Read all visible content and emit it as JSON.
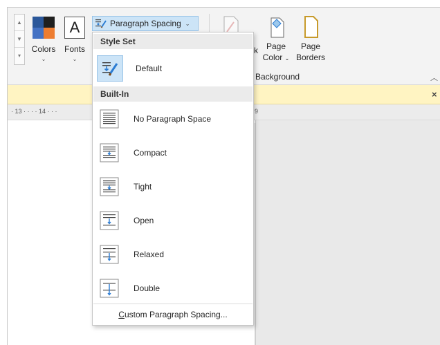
{
  "ribbon": {
    "colors_label": "Colors",
    "fonts_label": "Fonts",
    "fonts_glyph": "A",
    "paragraph_spacing_label": "Paragraph Spacing",
    "truncated_label": "k",
    "page_color_line1": "Page",
    "page_color_line2": "Color",
    "page_borders_line1": "Page",
    "page_borders_line2": "Borders",
    "group_label": "Background",
    "theme_colors": [
      "#2b579a",
      "#1f1f1f",
      "#4472c4",
      "#ed7d31"
    ]
  },
  "ruler": {
    "left_text": "· 13 · · · · 14 · · ·",
    "right_text": "9"
  },
  "message_bar": {
    "close_glyph": "×"
  },
  "dropdown": {
    "style_set_header": "Style Set",
    "default_label": "Default",
    "builtin_header": "Built-In",
    "items": [
      {
        "label": "No Paragraph Space",
        "icon": "no-paragraph-space-icon"
      },
      {
        "label": "Compact",
        "icon": "compact-spacing-icon"
      },
      {
        "label": "Tight",
        "icon": "tight-spacing-icon"
      },
      {
        "label": "Open",
        "icon": "open-spacing-icon"
      },
      {
        "label": "Relaxed",
        "icon": "relaxed-spacing-icon"
      },
      {
        "label": "Double",
        "icon": "double-spacing-icon"
      }
    ],
    "footer_label_accel": "C",
    "footer_label_rest": "ustom Paragraph Spacing..."
  },
  "colors": {
    "accent_blue": "#2b7cd3",
    "selected_bg": "#cce4f7",
    "message_bar_bg": "#fff4c2"
  }
}
